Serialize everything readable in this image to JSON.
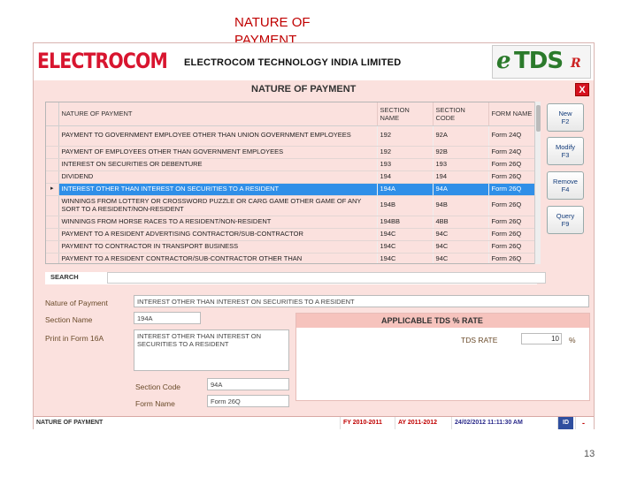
{
  "slide": {
    "title": "NATURE OF PAYMENT",
    "page_number": "13"
  },
  "header": {
    "logo_text": "ELECTROCOM",
    "company": "ELECTROCOM TECHNOLOGY INDIA LIMITED",
    "logo_right_e": "e",
    "logo_right_tds": "TDS",
    "logo_right_r": "R"
  },
  "dialog": {
    "title": "NATURE OF PAYMENT",
    "close": "X"
  },
  "grid": {
    "columns": [
      "NATURE OF PAYMENT",
      "SECTION NAME",
      "SECTION CODE",
      "FORM NAME"
    ],
    "rows": [
      {
        "nature": "PAYMENT TO GOVERNMENT EMPLOYEE OTHER THAN UNION GOVERNMENT EMPLOYEES",
        "section_name": "192",
        "section_code": "92A",
        "form": "Form 24Q"
      },
      {
        "nature": "PAYMENT OF EMPLOYEES OTHER THAN GOVERNMENT EMPLOYEES",
        "section_name": "192",
        "section_code": "92B",
        "form": "Form 24Q"
      },
      {
        "nature": "INTEREST ON SECURITIES OR DEBENTURE",
        "section_name": "193",
        "section_code": "193",
        "form": "Form 26Q"
      },
      {
        "nature": "DIVIDEND",
        "section_name": "194",
        "section_code": "194",
        "form": "Form 26Q"
      },
      {
        "nature": "INTEREST OTHER THAN INTEREST ON SECURITIES TO A RESIDENT",
        "section_name": "194A",
        "section_code": "94A",
        "form": "Form 26Q"
      },
      {
        "nature": "WINNINGS FROM LOTTERY OR CROSSWORD PUZZLE OR CARG GAME OTHER GAME OF ANY SORT TO A RESIDENT/NON-RESIDENT",
        "section_name": "194B",
        "section_code": "94B",
        "form": "Form 26Q"
      },
      {
        "nature": "WINNINGS FROM HORSE RACES TO A RESIDENT/NON-RESIDENT",
        "section_name": "194BB",
        "section_code": "4BB",
        "form": "Form 26Q"
      },
      {
        "nature": "PAYMENT TO A RESIDENT ADVERTISING CONTRACTOR/SUB-CONTRACTOR",
        "section_name": "194C",
        "section_code": "94C",
        "form": "Form 26Q"
      },
      {
        "nature": "PAYMENT TO CONTRACTOR IN TRANSPORT BUSINESS",
        "section_name": "194C",
        "section_code": "94C",
        "form": "Form 26Q"
      },
      {
        "nature": "PAYMENT TO A RESIDENT CONTRACTOR/SUB-CONTRACTOR OTHER THAN",
        "section_name": "194C",
        "section_code": "94C",
        "form": "Form 26Q"
      }
    ],
    "selected_index": 4,
    "row_indicator": "▸"
  },
  "buttons": {
    "new": {
      "label": "New",
      "key": "F2"
    },
    "modify": {
      "label": "Modify",
      "key": "F3"
    },
    "remove": {
      "label": "Remove",
      "key": "F4"
    },
    "query": {
      "label": "Query",
      "key": "F9"
    }
  },
  "search": {
    "label": "SEARCH",
    "value": ""
  },
  "form": {
    "nature_label": "Nature of Payment",
    "nature_value": "INTEREST OTHER THAN INTEREST ON SECURITIES TO A RESIDENT",
    "section_name_label": "Section Name",
    "section_name_value": "194A",
    "print_label": "Print in Form 16A",
    "print_value": "INTEREST OTHER THAN INTEREST ON SECURITIES TO A RESIDENT",
    "section_code_label": "Section Code",
    "section_code_value": "94A",
    "form_name_label": "Form Name",
    "form_name_value": "Form 26Q"
  },
  "tds": {
    "heading": "APPLICABLE TDS % RATE",
    "rate_label": "TDS RATE",
    "rate_value": "10",
    "pct": "%"
  },
  "status": {
    "screen": "NATURE OF PAYMENT",
    "fy": "FY 2010-2011",
    "ay": "AY 2011-2012",
    "datetime": "24/02/2012 11:11:30 AM",
    "id": "ID",
    "minus": "-"
  }
}
